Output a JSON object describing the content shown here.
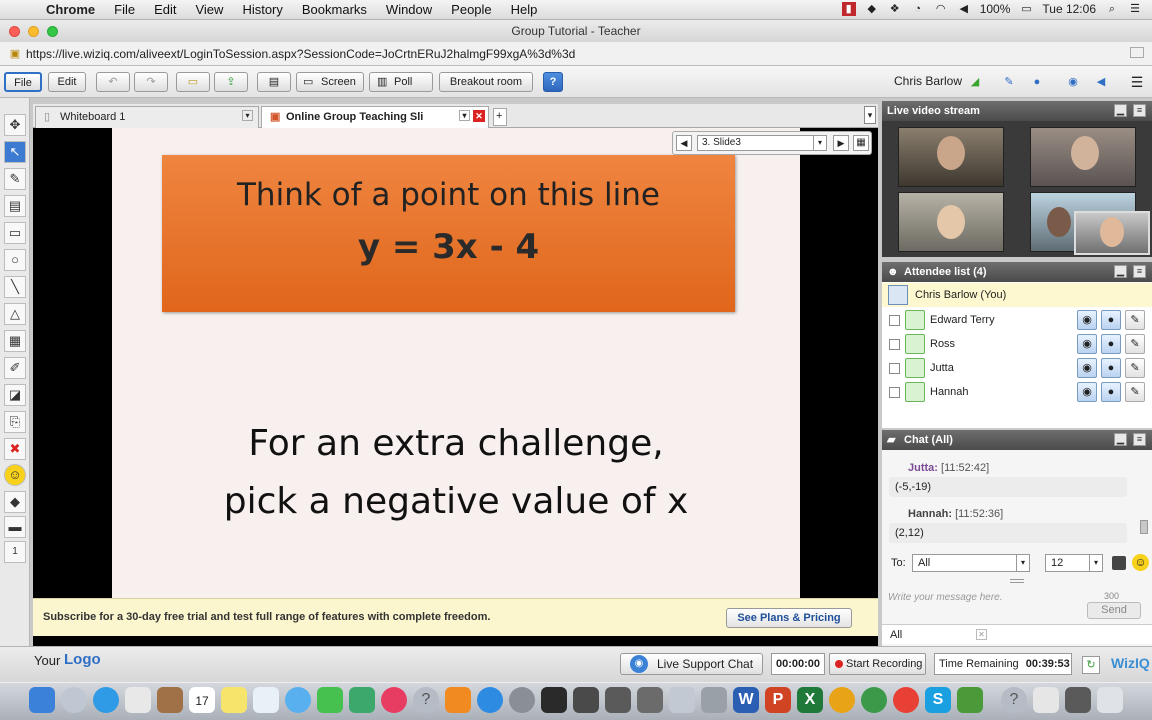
{
  "menubar": {
    "app": "Chrome",
    "items": [
      "File",
      "Edit",
      "View",
      "History",
      "Bookmarks",
      "Window",
      "People",
      "Help"
    ],
    "battery": "100%",
    "clock": "Tue 12:06"
  },
  "window": {
    "title": "Group Tutorial - Teacher"
  },
  "url": "https://live.wiziq.com/aliveext/LoginToSession.aspx?SessionCode=JoCrtnERuJ2halmgF99xgA%3d%3d",
  "toolbar": {
    "file": "File",
    "edit": "Edit",
    "screen": "Screen",
    "poll": "Poll",
    "breakout": "Breakout room",
    "help": "?",
    "user": "Chris Barlow"
  },
  "tabs": [
    "Whiteboard 1",
    "Online Group Teaching Sli"
  ],
  "slide_nav": {
    "current": "3. Slide3"
  },
  "slide": {
    "line1": "Think of a point on this line",
    "line2": "y = 3x - 4",
    "challenge1": "For an extra challenge,",
    "challenge2": "pick a negative value of x"
  },
  "subscribe": {
    "text": "Subscribe for a 30-day free trial and test full range of features with complete freedom.",
    "button": "See Plans & Pricing"
  },
  "logo": {
    "your": "Your",
    "logo": "Logo"
  },
  "video": {
    "title": "Live video stream"
  },
  "attendees": {
    "title": "Attendee list (4)",
    "me": "Chris Barlow (You)",
    "list": [
      "Edward Terry",
      "Ross",
      "Jutta",
      "Hannah"
    ]
  },
  "chat": {
    "title": "Chat (All)",
    "messages": [
      {
        "name": "Jutta:",
        "time": "[11:52:42]",
        "text": "(-5,-19)"
      },
      {
        "name": "Hannah:",
        "time": "[11:52:36]",
        "text": "(2,12)"
      }
    ],
    "to_label": "To:",
    "to_value": "All",
    "font_size": "12",
    "placeholder": "Write your message here.",
    "counter": "300",
    "send": "Send",
    "filter": "All"
  },
  "status": {
    "support": "Live Support Chat",
    "timer": "00:00:00",
    "record": "Start Recording",
    "remaining_label": "Time Remaining",
    "remaining": "00:39:53",
    "brand": "WizIQ"
  },
  "colors": {
    "accent": "#2f6fc6",
    "slide_orange": "#e8742c",
    "panel_head": "#555555"
  },
  "dock": {
    "calendar_day": "17"
  }
}
